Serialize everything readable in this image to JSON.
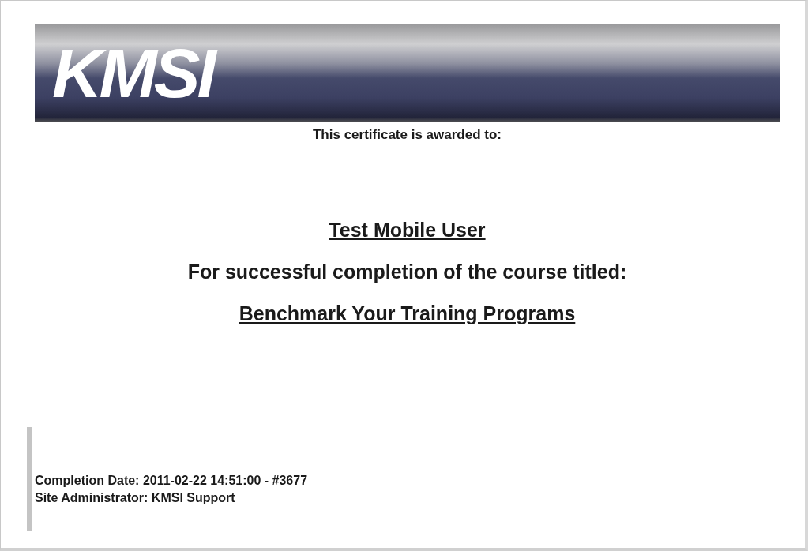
{
  "banner": {
    "logo": "KMSI"
  },
  "certificate": {
    "intro": "This certificate is awarded to:",
    "recipient": "Test Mobile User",
    "course_intro": "For successful completion of the course titled:",
    "course_title": "Benchmark Your Training Programs"
  },
  "footer": {
    "completion": "Completion Date: 2011-02-22 14:51:00 - #3677",
    "administrator": "Site Administrator: KMSI Support"
  }
}
